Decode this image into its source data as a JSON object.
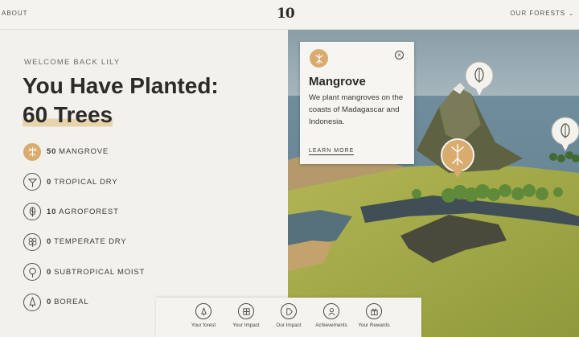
{
  "topbar": {
    "about": "ABOUT",
    "logo": "10",
    "our_forests": "OUR FORESTS"
  },
  "left": {
    "welcome": "WELCOME BACK LILY",
    "headline_line1": "You Have Planted:",
    "headline_line2": "60 Trees",
    "forests": [
      {
        "count": "50",
        "name": "MANGROVE",
        "icon": "mangrove-icon",
        "active": true
      },
      {
        "count": "0",
        "name": "TROPICAL DRY",
        "icon": "tropical-dry-icon",
        "active": false
      },
      {
        "count": "10",
        "name": "AGROFOREST",
        "icon": "agroforest-icon",
        "active": false
      },
      {
        "count": "0",
        "name": "TEMPERATE DRY",
        "icon": "temperate-dry-icon",
        "active": false
      },
      {
        "count": "0",
        "name": "SUBTROPICAL MOIST",
        "icon": "subtropical-moist-icon",
        "active": false
      },
      {
        "count": "0",
        "name": "BOREAL",
        "icon": "boreal-icon",
        "active": false
      }
    ]
  },
  "card": {
    "title": "Mangrove",
    "description": "We plant mangroves on the coasts of Madagascar and Indonesia.",
    "link": "LEARN MORE"
  },
  "bottom_nav": [
    {
      "label": "Your forest",
      "icon": "tree-icon"
    },
    {
      "label": "Your Impact",
      "icon": "impact-icon"
    },
    {
      "label": "Our Impact",
      "icon": "our-impact-icon"
    },
    {
      "label": "Achievements",
      "icon": "achievements-icon"
    },
    {
      "label": "Your Rewards",
      "icon": "rewards-icon"
    }
  ],
  "colors": {
    "accent": "#d8ab6e",
    "panel": "#f2f1ed",
    "text": "#2c2b28",
    "grass": "#a4ac4a",
    "water": "#6e8e9f"
  }
}
